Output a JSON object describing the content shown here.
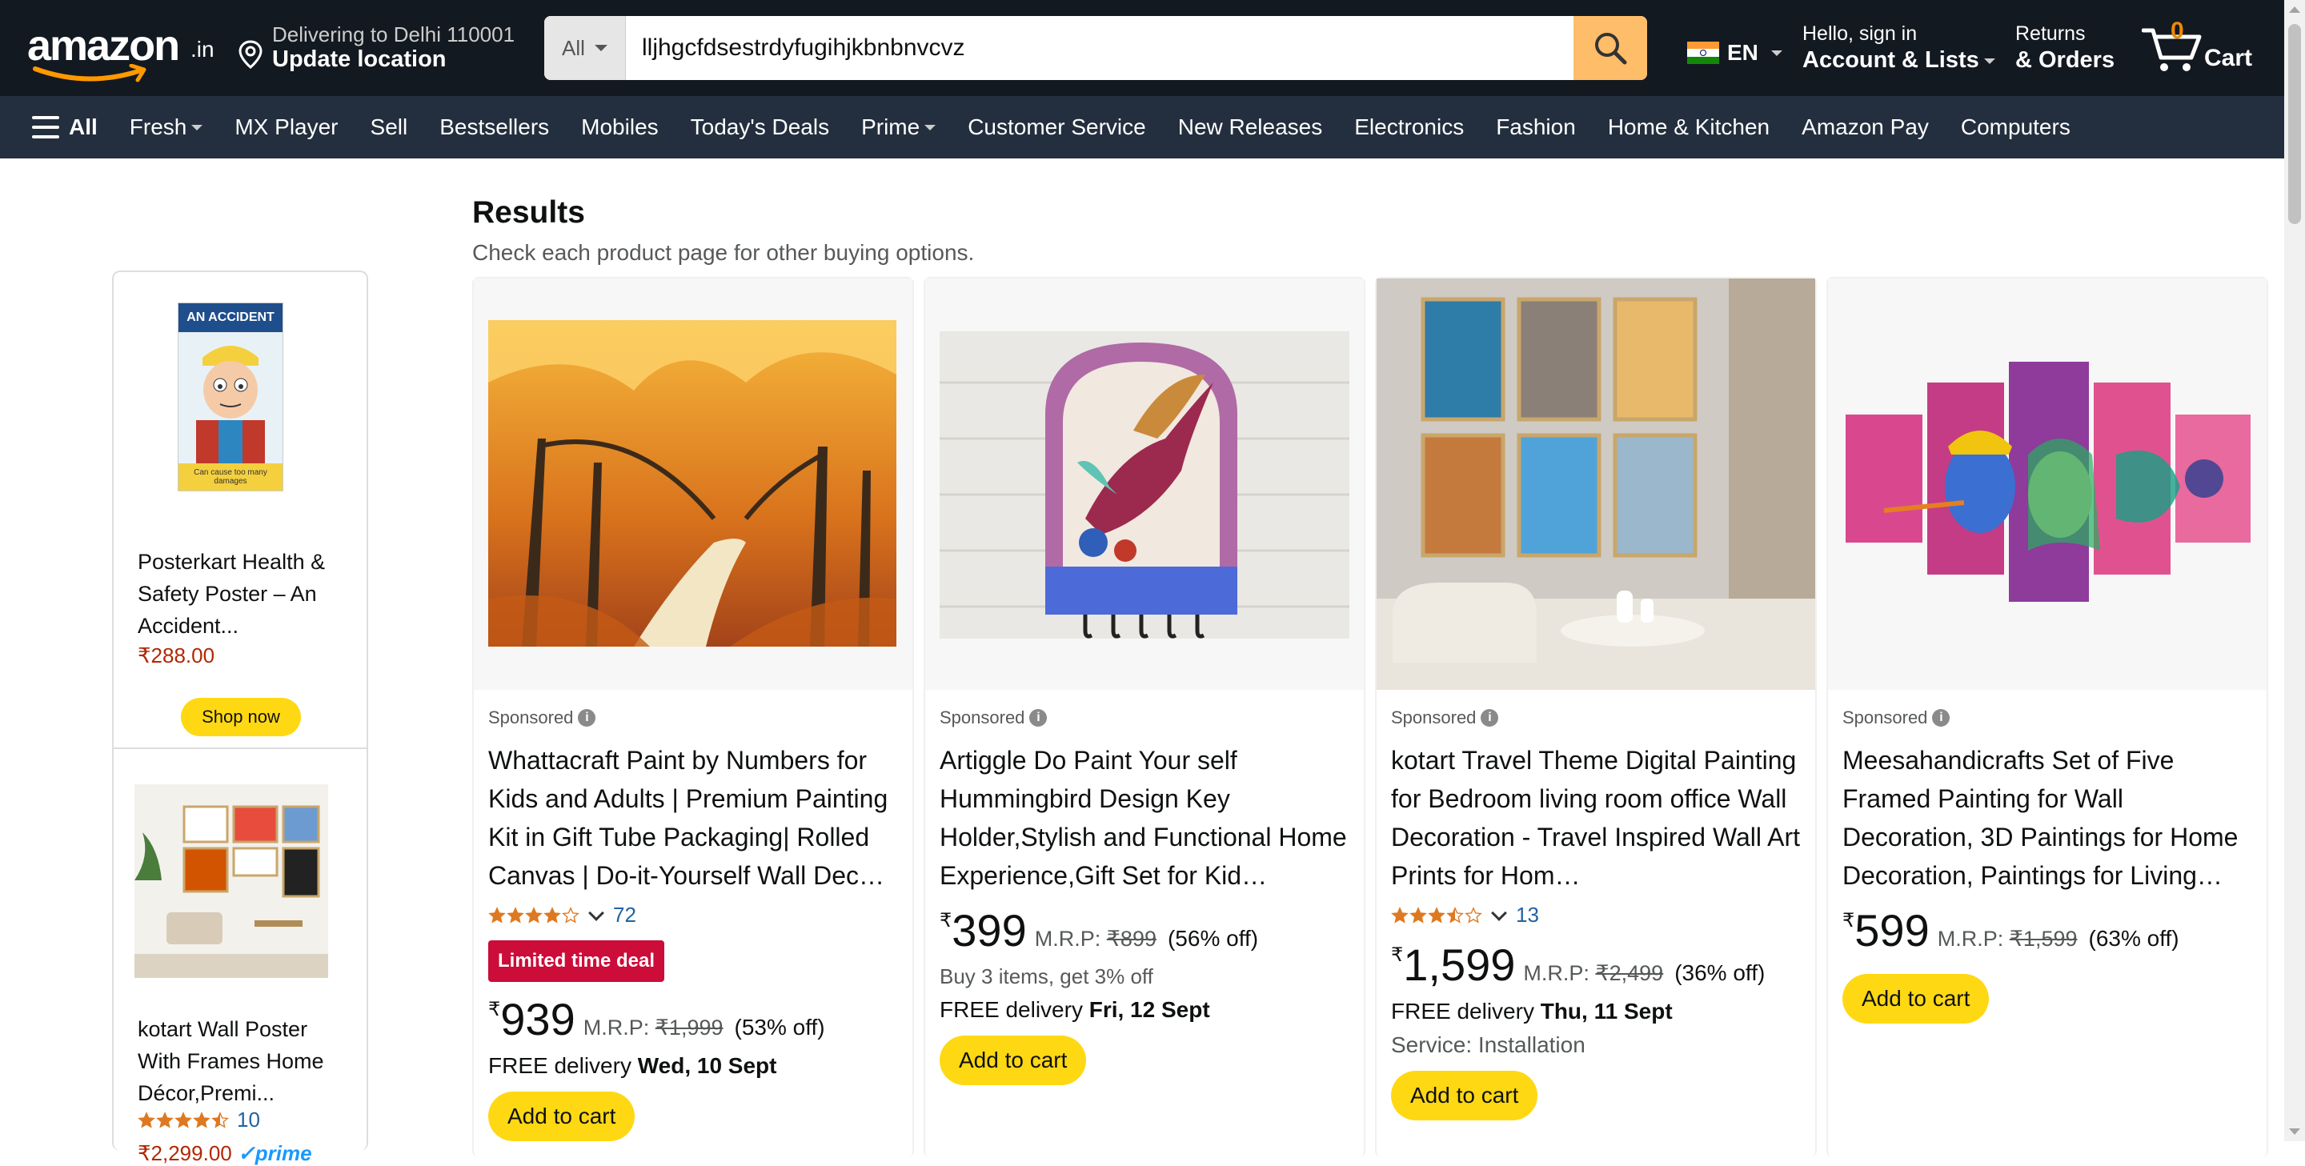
{
  "header": {
    "logo_text": "amazon",
    "logo_tld": ".in",
    "deliver_line1": "Delivering to Delhi 110001",
    "deliver_line2": "Update location",
    "search_category": "All",
    "search_value": "lljhgcfdsestrdyfugihjkbnbnvcvz",
    "lang": "EN",
    "account_line1": "Hello, sign in",
    "account_line2": "Account & Lists",
    "orders_line1": "Returns",
    "orders_line2": "& Orders",
    "cart_count": "0",
    "cart_label": "Cart"
  },
  "subnav": {
    "all_label": "All",
    "items": [
      "Fresh",
      "MX Player",
      "Sell",
      "Bestsellers",
      "Mobiles",
      "Today's Deals",
      "Prime",
      "Customer Service",
      "New Releases",
      "Electronics",
      "Fashion",
      "Home & Kitchen",
      "Amazon Pay",
      "Computers"
    ]
  },
  "results": {
    "title": "Results",
    "subtitle": "Check each product page for other buying options."
  },
  "left_ads": [
    {
      "image_text_top": "AN ACCIDENT",
      "image_text_bottom": "Can cause too many damages",
      "title": "Posterkart Health & Safety Poster – An Accident...",
      "price": "₹288.00",
      "button": "Shop now"
    },
    {
      "title": "kotart Wall Poster With Frames Home Décor,Premi...",
      "rating": 4.5,
      "reviews": "10",
      "price": "₹2,299.00",
      "prime": "prime"
    }
  ],
  "products": [
    {
      "sponsored": "Sponsored",
      "title": "Whattacraft Paint by Numbers for Kids and Adults | Premium Painting Kit in Gift Tube Packaging| Rolled Canvas | Do-it-Yourself Wall Dec…",
      "rating": 4.0,
      "reviews": "72",
      "deal": "Limited time deal",
      "currency": "₹",
      "price": "939",
      "mrp_label": "M.R.P:",
      "mrp": "₹1,999",
      "off": "(53% off)",
      "delivery_prefix": "FREE delivery",
      "delivery_date": "Wed, 10 Sept",
      "button": "Add to cart"
    },
    {
      "sponsored": "Sponsored",
      "title": "Artiggle Do Paint Your self Hummingbird Design Key Holder,Stylish and Functional Home Experience,Gift Set for Kid…",
      "currency": "₹",
      "price": "399",
      "mrp_label": "M.R.P:",
      "mrp": "₹899",
      "off": "(56% off)",
      "offer": "Buy 3 items, get 3% off",
      "delivery_prefix": "FREE delivery",
      "delivery_date": "Fri, 12 Sept",
      "button": "Add to cart"
    },
    {
      "sponsored": "Sponsored",
      "title": "kotart Travel Theme Digital Painting for Bedroom living room office Wall Decoration - Travel Inspired Wall Art Prints for Hom…",
      "rating": 3.5,
      "reviews": "13",
      "currency": "₹",
      "price": "1,599",
      "mrp_label": "M.R.P:",
      "mrp": "₹2,499",
      "off": "(36% off)",
      "delivery_prefix": "FREE delivery",
      "delivery_date": "Thu, 11 Sept",
      "service": "Service: Installation",
      "button": "Add to cart"
    },
    {
      "sponsored": "Sponsored",
      "title": "Meesahandicrafts Set of Five Framed Painting for Wall Decoration, 3D Paintings for Home Decoration, Paintings for Living…",
      "currency": "₹",
      "price": "599",
      "mrp_label": "M.R.P:",
      "mrp": "₹1,599",
      "off": "(63% off)",
      "button": "Add to cart"
    }
  ],
  "colors": {
    "nav_bg": "#131921",
    "subnav_bg": "#232f3e",
    "search_btn": "#febd69",
    "add_to_cart": "#ffd814",
    "deal_badge": "#cc0c39",
    "price_red": "#b12704",
    "link_blue": "#2162a1",
    "star": "#de7921"
  },
  "icons": [
    "amazon-smile-icon",
    "location-pin-icon",
    "search-icon",
    "india-flag-icon",
    "cart-icon",
    "hamburger-icon",
    "info-icon",
    "star-icon",
    "chevron-down-icon"
  ]
}
